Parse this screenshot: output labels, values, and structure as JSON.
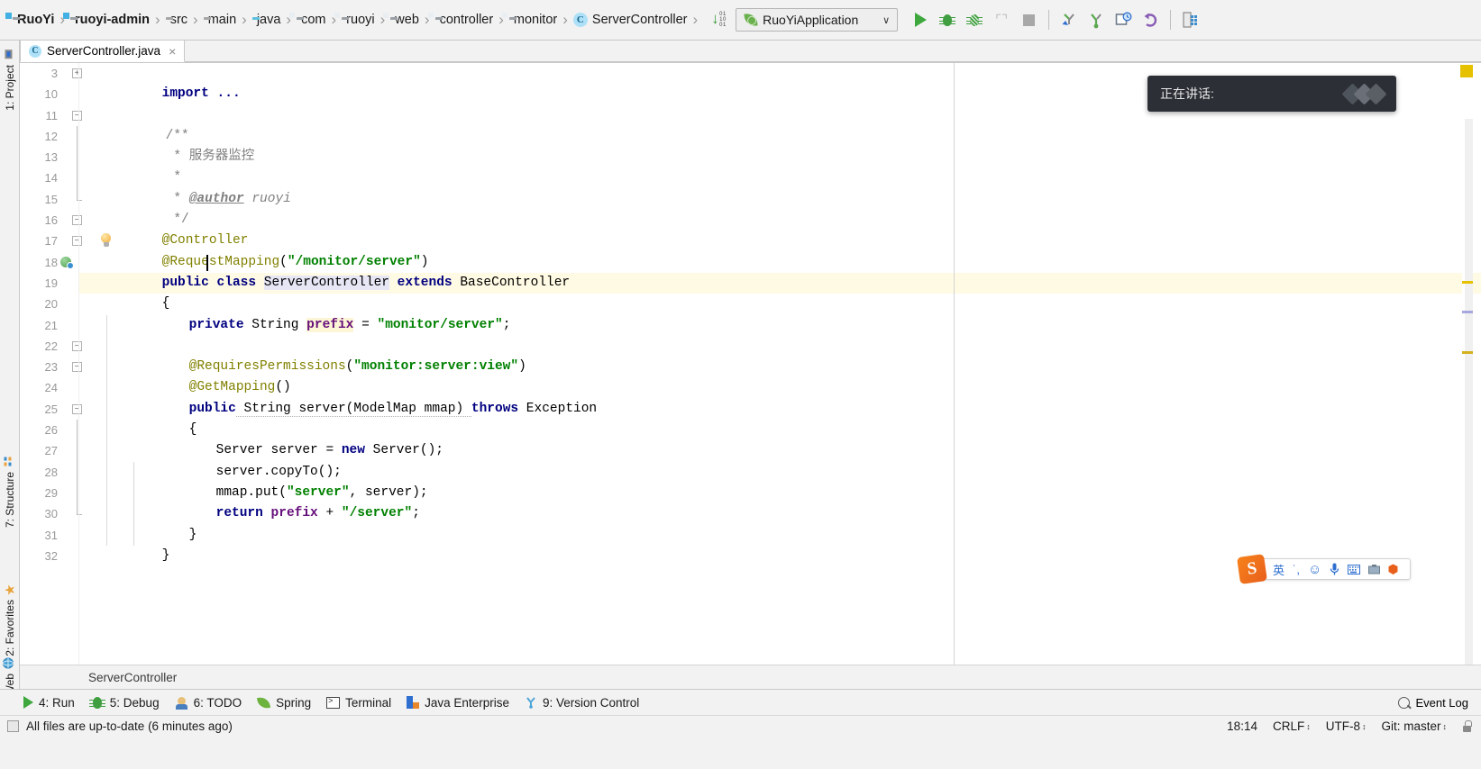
{
  "toolbar": {
    "breadcrumbs": [
      {
        "label": "RuoYi",
        "icon": "module-icon",
        "bold": true
      },
      {
        "label": "ruoyi-admin",
        "icon": "module-icon",
        "bold": true
      },
      {
        "label": "src",
        "icon": "folder-icon",
        "bold": false
      },
      {
        "label": "main",
        "icon": "folder-icon",
        "bold": false
      },
      {
        "label": "java",
        "icon": "folder-blue-icon",
        "bold": false
      },
      {
        "label": "com",
        "icon": "package-icon",
        "bold": false
      },
      {
        "label": "ruoyi",
        "icon": "package-icon",
        "bold": false
      },
      {
        "label": "web",
        "icon": "package-icon",
        "bold": false
      },
      {
        "label": "controller",
        "icon": "package-icon",
        "bold": false
      },
      {
        "label": "monitor",
        "icon": "package-icon",
        "bold": false
      },
      {
        "label": "ServerController",
        "icon": "java-class-icon",
        "bold": false
      }
    ],
    "separator": "›",
    "sort_icon": "sort-alphabetically-icon",
    "sort_digits_top": "01",
    "sort_digits_mid": "10",
    "sort_digits_bot": "01",
    "run_config": {
      "name": "RuoYiApplication",
      "icon": "spring-boot-icon",
      "chevron": "∨"
    },
    "actions": [
      {
        "name": "run-button",
        "icon": "run-triangle-icon"
      },
      {
        "name": "debug-button",
        "icon": "debug-bug-icon"
      },
      {
        "name": "run-with-coverage-button",
        "icon": "coverage-bug-icon"
      },
      {
        "name": "profile-button",
        "icon": "profiler-icon"
      },
      {
        "name": "stop-button",
        "icon": "stop-square-icon"
      },
      {
        "name": "update-project-button",
        "icon": "vcs-update-icon"
      },
      {
        "name": "commit-button",
        "icon": "vcs-commit-icon"
      },
      {
        "name": "vcs-history-button",
        "icon": "vcs-history-icon"
      },
      {
        "name": "rollback-button",
        "icon": "vcs-rollback-icon"
      },
      {
        "name": "database-button",
        "icon": "database-icon"
      }
    ]
  },
  "left_strip": {
    "tabs": [
      {
        "label": "1: Project",
        "icon": "project-icon"
      },
      {
        "label": "7: Structure",
        "icon": "structure-icon"
      },
      {
        "label": "2: Favorites",
        "icon": "star-icon"
      },
      {
        "label": "Web",
        "icon": "web-icon"
      }
    ]
  },
  "editor_tabs": [
    {
      "label": "ServerController.java",
      "icon": "java-class-icon",
      "close": "×",
      "active": true
    }
  ],
  "editor": {
    "breadcrumb": "ServerController",
    "caret_line": 18,
    "lines": [
      {
        "num": "3",
        "fold": "plus"
      },
      {
        "num": "10",
        "fold": ""
      },
      {
        "num": "11",
        "fold": "minus-top"
      },
      {
        "num": "12",
        "fold": ""
      },
      {
        "num": "13",
        "fold": ""
      },
      {
        "num": "14",
        "fold": ""
      },
      {
        "num": "15",
        "fold": "minus-bot"
      },
      {
        "num": "16",
        "fold": "minus-top"
      },
      {
        "num": "17",
        "fold": "minus-top"
      },
      {
        "num": "18",
        "fold": "",
        "marker": "run-marker"
      },
      {
        "num": "19",
        "fold": ""
      },
      {
        "num": "20",
        "fold": ""
      },
      {
        "num": "21",
        "fold": ""
      },
      {
        "num": "22",
        "fold": "minus-top"
      },
      {
        "num": "23",
        "fold": "minus-bot"
      },
      {
        "num": "24",
        "fold": ""
      },
      {
        "num": "25",
        "fold": "minus-top"
      },
      {
        "num": "26",
        "fold": ""
      },
      {
        "num": "27",
        "fold": ""
      },
      {
        "num": "28",
        "fold": ""
      },
      {
        "num": "29",
        "fold": ""
      },
      {
        "num": "30",
        "fold": "minus-bot"
      },
      {
        "num": "31",
        "fold": ""
      },
      {
        "num": "32",
        "fold": ""
      }
    ],
    "code": {
      "l3": "import ...",
      "l11": "/**",
      "l12": " * 服务器监控",
      "l13": " *",
      "l14_star": " * ",
      "l14_tag": "@author",
      "l14_val": " ruoyi",
      "l15": " */",
      "l16": "@Controller",
      "l17_anno": "@RequestMapping",
      "l17_str": "\"/monitor/server\"",
      "l18_kw1": "public class ",
      "l18_name": "ServerController",
      "l18_kw2": " extends ",
      "l18_base": "BaseController",
      "l19": "{",
      "l20_kw": "private",
      "l20_type": " String ",
      "l20_field": "prefix",
      "l20_eq": " = ",
      "l20_str": "\"monitor/server\"",
      "l20_end": ";",
      "l22_anno": "@RequiresPermissions",
      "l22_str": "\"monitor:server:view\"",
      "l23_anno": "@GetMapping",
      "l24_kw": "public",
      "l24_sig": " String server(ModelMap mmap) ",
      "l24_throws": "throws",
      "l24_exc": " Exception",
      "l25": "{",
      "l26_a": "Server server = ",
      "l26_new": "new",
      "l26_b": " Server();",
      "l27": "server.copyTo();",
      "l28_a": "mmap.put(",
      "l28_str": "\"server\"",
      "l28_b": ", server);",
      "l29_ret": "return ",
      "l29_field": "prefix",
      "l29_plus": " + ",
      "l29_str": "\"/server\"",
      "l29_end": ";",
      "l30": "}",
      "l31": "}"
    }
  },
  "speech_popup": {
    "text": "正在讲话:",
    "icon": "sound-wave-icon"
  },
  "ime_bar": {
    "logo": "S",
    "items": [
      {
        "label": "英",
        "name": "ime-language-toggle"
      },
      {
        "label": "˙,",
        "name": "ime-punctuation-toggle"
      },
      {
        "label": "☺",
        "name": "ime-emoji-button"
      },
      {
        "label": "🎙",
        "name": "ime-voice-input-button"
      },
      {
        "label": "⌨",
        "name": "ime-soft-keyboard-button"
      },
      {
        "label": "⚙",
        "name": "ime-toolbox-button"
      },
      {
        "label": "☰",
        "name": "ime-menu-button"
      }
    ]
  },
  "tool_window_bar": {
    "items": [
      {
        "label": "4: Run",
        "underline": "4",
        "icon": "run-triangle-icon"
      },
      {
        "label": "5: Debug",
        "underline": "5",
        "icon": "debug-bug-icon"
      },
      {
        "label": "6: TODO",
        "underline": "6",
        "icon": "todo-icon"
      },
      {
        "label": "Spring",
        "underline": "",
        "icon": "spring-leaf-icon"
      },
      {
        "label": "Terminal",
        "underline": "",
        "icon": "terminal-icon"
      },
      {
        "label": "Java Enterprise",
        "underline": "",
        "icon": "java-enterprise-icon"
      },
      {
        "label": "9: Version Control",
        "underline": "9",
        "icon": "version-control-icon"
      }
    ],
    "event_log": {
      "label": "Event Log",
      "icon": "event-log-icon"
    }
  },
  "status_bar": {
    "message": "All files are up-to-date (6 minutes ago)",
    "time": "18:14",
    "line_separator": "CRLF",
    "encoding": "UTF-8",
    "branch": "Git: master",
    "lock_icon": "lock-icon",
    "stepper": "↕"
  }
}
